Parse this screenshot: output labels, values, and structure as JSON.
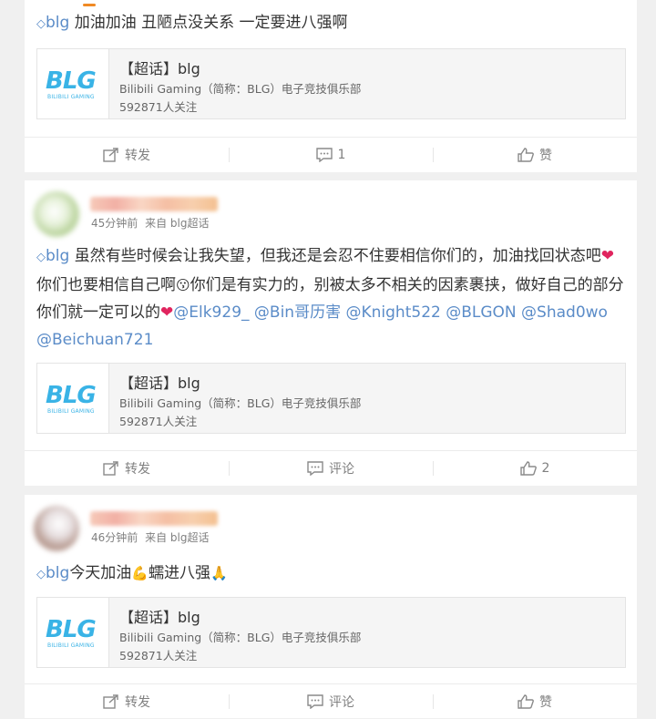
{
  "posts": [
    {
      "text_html": "<span class=\"topic-icon\">&#9671;</span><span class=\"link\">blg</span> 加油加油 丑陋点没关系 一定要进八强啊",
      "topic": {
        "title": "【超话】blg",
        "desc": "Bilibili Gaming（简称：BLG）电子竞技俱乐部",
        "followers": "592871人关注",
        "logo_text": "BLG",
        "logo_sub": "BILIBILI GAMING"
      },
      "actions": {
        "repost": "转发",
        "comment": "1",
        "like": "赞"
      }
    },
    {
      "author": {
        "time": "45分钟前",
        "source": "来自 blg超话"
      },
      "text_html": "<span class=\"topic-icon\">&#9671;</span><span class=\"link\">blg</span> 虽然有些时候会让我失望，但我还是会忍不住要相信你们的，加油找回状态吧<span class=\"heart\">&#10084;</span>你们也要相信自己啊<span class=\"emoji\">&#128535;</span>你们是有实力的，别被太多不相关的因素裹挟，做好自己的部分你们就一定可以的<span class=\"heart\">&#10084;</span><span class=\"link\">@Elk929_</span> <span class=\"link\">@Bin哥历害</span> <span class=\"link\">@Knight522</span> <span class=\"link\">@BLGON</span> <span class=\"link\">@Shad0wo</span> <span class=\"link\">@Beichuan721</span>",
      "topic": {
        "title": "【超话】blg",
        "desc": "Bilibili Gaming（简称：BLG）电子竞技俱乐部",
        "followers": "592871人关注",
        "logo_text": "BLG",
        "logo_sub": "BILIBILI GAMING"
      },
      "actions": {
        "repost": "转发",
        "comment": "评论",
        "like": "2"
      }
    },
    {
      "author": {
        "time": "46分钟前",
        "source": "来自 blg超话"
      },
      "text_html": "<span class=\"topic-icon\">&#9671;</span><span class=\"link\">blg</span>今天加油<span class=\"emoji\">&#128170;</span>蠕进八强<span class=\"emoji\">&#128591;</span>",
      "topic": {
        "title": "【超话】blg",
        "desc": "Bilibili Gaming（简称：BLG）电子竞技俱乐部",
        "followers": "592871人关注",
        "logo_text": "BLG",
        "logo_sub": "BILIBILI GAMING"
      },
      "actions": {
        "repost": "转发",
        "comment": "评论",
        "like": "赞"
      }
    }
  ],
  "icons": {
    "repost": "repost-icon",
    "comment": "comment-icon",
    "like": "like-icon",
    "topic": "diamond-icon"
  }
}
